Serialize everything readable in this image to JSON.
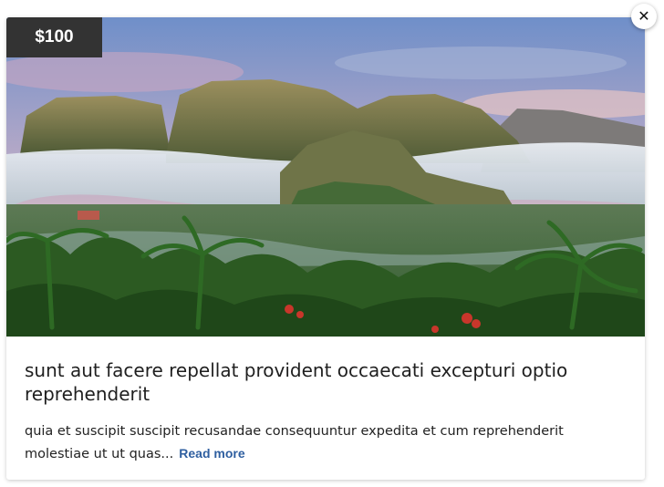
{
  "card": {
    "price": "$100",
    "title": "sunt aut facere repellat provident occaecati excepturi optio reprehenderit",
    "excerpt": "quia et suscipit suscipit recusandae consequuntur expedita et cum reprehenderit molestiae ut ut quas...",
    "read_more": "Read more",
    "image_subject": "misty valley with limestone mountains and palm trees"
  },
  "close_icon": "close-icon",
  "colors": {
    "badge_bg": "#333333",
    "link": "#2f5fa0"
  }
}
